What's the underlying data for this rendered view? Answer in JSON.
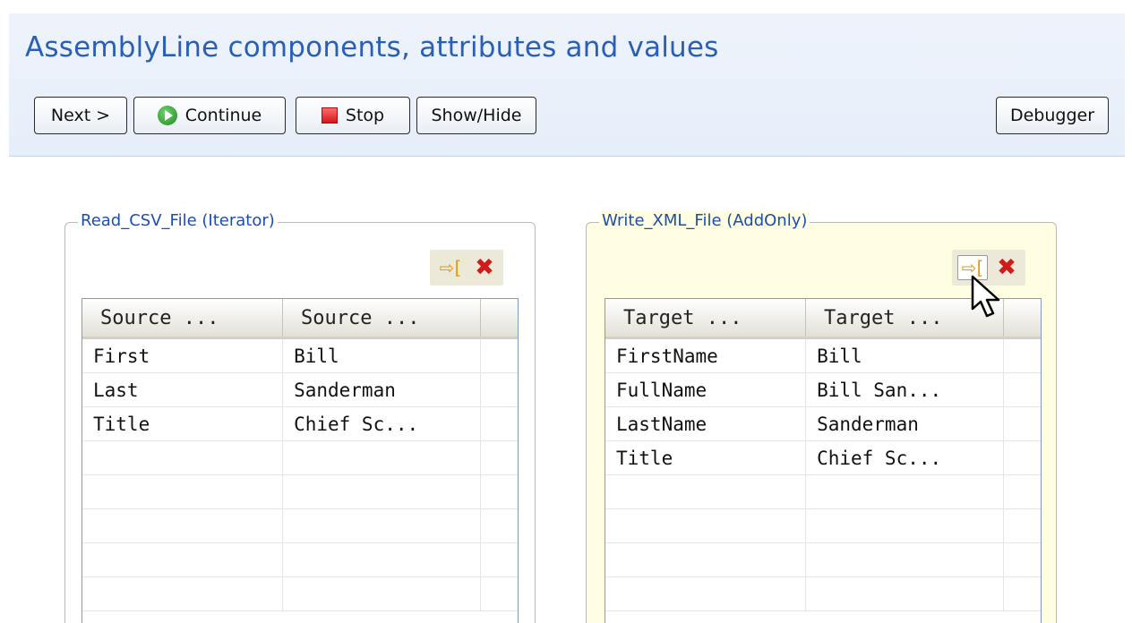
{
  "header": {
    "title": "AssemblyLine components, attributes and values"
  },
  "toolbar": {
    "next_label": "Next >",
    "continue_label": "Continue",
    "stop_label": "Stop",
    "showhide_label": "Show/Hide",
    "debugger_label": "Debugger"
  },
  "left_panel": {
    "title": "Read_CSV_File (Iterator)",
    "columns": [
      "Source ...",
      "Source ..."
    ],
    "rows": [
      [
        "First",
        "Bill"
      ],
      [
        "Last",
        "Sanderman"
      ],
      [
        "Title",
        "Chief Sc..."
      ]
    ]
  },
  "right_panel": {
    "title": "Write_XML_File (AddOnly)",
    "columns": [
      "Target ...",
      "Target ..."
    ],
    "rows": [
      [
        "FirstName",
        "Bill"
      ],
      [
        "FullName",
        "Bill San..."
      ],
      [
        "LastName",
        "Sanderman"
      ],
      [
        "Title",
        "Chief Sc..."
      ]
    ]
  },
  "icons": {
    "map_attribute": "map-attribute-icon",
    "delete": "delete-icon",
    "continue": "play-icon",
    "stop": "stop-icon",
    "pointer": "mouse-pointer-icon"
  },
  "colors": {
    "title_blue": "#2b5fb3",
    "legend_blue": "#1a4fb0",
    "target_panel_bg": "#fffde2",
    "delete_red": "#d11a1a",
    "map_orange": "#e39b10"
  }
}
